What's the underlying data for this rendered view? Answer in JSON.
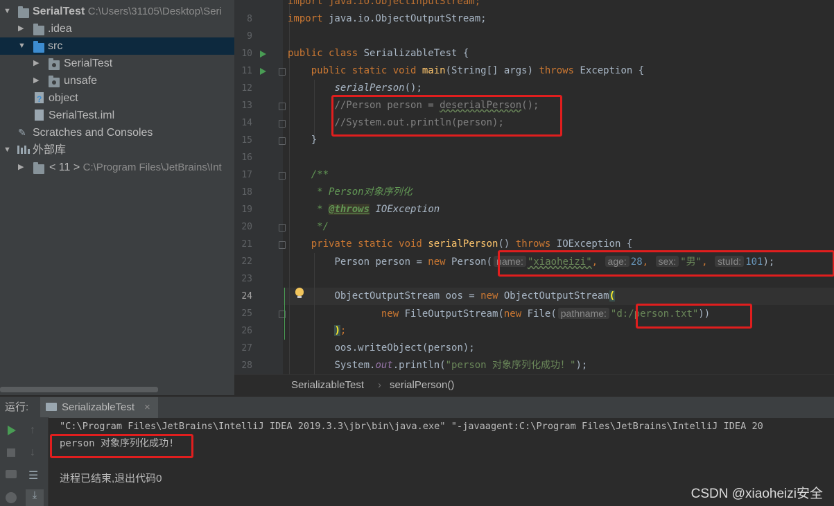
{
  "project_tree": {
    "root": {
      "name": "SerialTest",
      "path": "C:\\Users\\31105\\Desktop\\Seri"
    },
    "idea": ".idea",
    "src": "src",
    "pkg_serialtest": "SerialTest",
    "pkg_unsafe": "unsafe",
    "object_file": "object",
    "iml_file": "SerialTest.iml",
    "scratches": "Scratches and Consoles",
    "external_libs": "外部库",
    "jdk": {
      "name": "< 11 >",
      "path": "C:\\Program Files\\JetBrains\\Int"
    }
  },
  "editor": {
    "line_numbers": [
      "8",
      "9",
      "10",
      "11",
      "12",
      "13",
      "14",
      "15",
      "16",
      "17",
      "18",
      "19",
      "20",
      "21",
      "22",
      "23",
      "24",
      "25",
      "26",
      "27",
      "28"
    ],
    "line7": "import java.io.ObjectInputStream;",
    "line8": {
      "kw": "import",
      "rest": " java.io.ObjectOutputStream;"
    },
    "line10": {
      "kw": "public class",
      "name": " SerializableTest {"
    },
    "line11": {
      "kw": "public static void",
      "fn": "main",
      "args": "(String[] args) ",
      "throws": "throws",
      "ex": " Exception {"
    },
    "line12": {
      "call": "serialPerson",
      "end": "();"
    },
    "line13": {
      "a": "//Person person = ",
      "b": "deserialPerson",
      "c": "();"
    },
    "line14": "//System.out.println(person);",
    "line15": "}",
    "line17": "/**",
    "line18": " * Person对象序列化",
    "line19": {
      "star": " * ",
      "tag": "@throws",
      "ex": " IOException"
    },
    "line20": " */",
    "line21": {
      "kw": "private static void",
      "fn": "serialPerson",
      "paren": "() ",
      "throws": "throws",
      "ex": " IOException {"
    },
    "line22": {
      "a": "Person person = ",
      "new": "new",
      "b": " Person(",
      "h1": "name:",
      "s1": "\"xiaoheizi\"",
      "comma": ",",
      "h2": "age:",
      "n1": "28",
      "h3": "sex:",
      "s2": "\"男\"",
      "h4": "stuId:",
      "n2": "101",
      "end": ");"
    },
    "line24": {
      "a": "ObjectOutputStream oos = ",
      "new": "new",
      "b": " ObjectOutputStream",
      "paren": "("
    },
    "line25": {
      "new1": "new",
      "a": " FileOutputStream(",
      "new2": "new",
      "b": " File(",
      "h": "pathname:",
      "s": "\"d:/person.txt\"",
      "end": "))"
    },
    "line26": {
      "paren": ")",
      "semi": ";"
    },
    "line27": "oos.writeObject(person);",
    "line28": {
      "a": "System.",
      "out": "out",
      "b": ".println(",
      "s": "\"person 对象序列化成功！\"",
      "end": ");"
    }
  },
  "breadcrumb": {
    "class": "SerializableTest",
    "sep": "›",
    "method": "serialPerson()"
  },
  "run_panel": {
    "label": "运行:",
    "tab": "SerializableTest",
    "tab_close": "×",
    "cmd": "\"C:\\Program Files\\JetBrains\\IntelliJ IDEA 2019.3.3\\jbr\\bin\\java.exe\" \"-javaagent:C:\\Program Files\\JetBrains\\IntelliJ IDEA 20",
    "output": "person 对象序列化成功!",
    "exit": "进程已结束,退出代码0"
  },
  "watermark": "CSDN @xiaoheizi安全",
  "colors": {
    "keyword": "#cc7832",
    "string": "#6a8759",
    "comment": "#808080",
    "highlight_box": "#e01e1e",
    "selection": "#0d293e"
  }
}
